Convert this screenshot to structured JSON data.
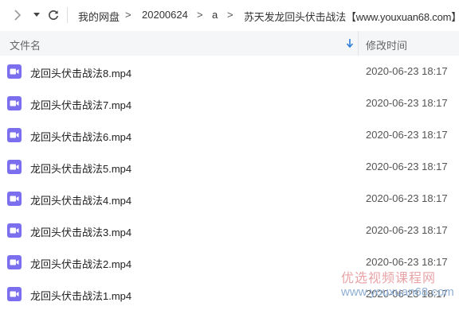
{
  "nav": {
    "forward_icon": "chevron-right-icon",
    "dropdown_icon": "caret-down-icon",
    "refresh_icon": "refresh-icon"
  },
  "breadcrumb": {
    "items": [
      "我的网盘",
      "20200624",
      "a",
      "苏天发龙回头伏击战法【www.youxuan68.com】"
    ],
    "separator": ">"
  },
  "table": {
    "col_name": "文件名",
    "col_date": "修改时间",
    "sort_icon": "sort-down-arrow-icon",
    "rows": [
      {
        "name": "龙回头伏击战法8.mp4",
        "date": "2020-06-23 18:17"
      },
      {
        "name": "龙回头伏击战法7.mp4",
        "date": "2020-06-23 18:17"
      },
      {
        "name": "龙回头伏击战法6.mp4",
        "date": "2020-06-23 18:17"
      },
      {
        "name": "龙回头伏击战法5.mp4",
        "date": "2020-06-23 18:17"
      },
      {
        "name": "龙回头伏击战法4.mp4",
        "date": "2020-06-23 18:17"
      },
      {
        "name": "龙回头伏击战法3.mp4",
        "date": "2020-06-23 18:17"
      },
      {
        "name": "龙回头伏击战法2.mp4",
        "date": "2020-06-23 18:17"
      },
      {
        "name": "龙回头伏击战法1.mp4",
        "date": "2020-06-23 18:17"
      }
    ]
  },
  "watermark": {
    "title": "优选视频课程网",
    "url": "www.youxuan68.com"
  },
  "colors": {
    "video_icon": "#7b6ff0",
    "header_bg": "#f5f6f8",
    "sort_arrow": "#2f7fd8"
  }
}
